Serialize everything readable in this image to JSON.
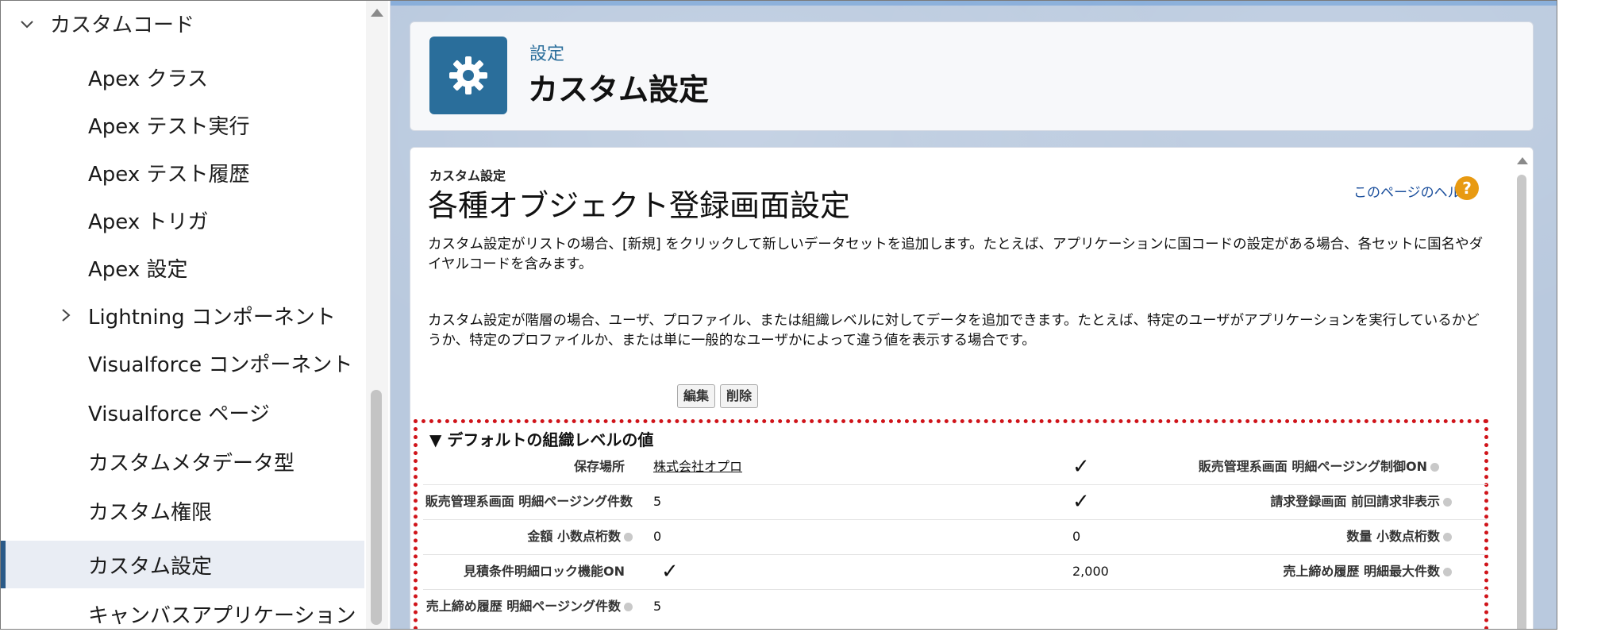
{
  "sidebar": {
    "section_label": "カスタムコード",
    "items": [
      {
        "label": "Apex クラス"
      },
      {
        "label": "Apex テスト実行"
      },
      {
        "label": "Apex テスト履歴"
      },
      {
        "label": "Apex トリガ"
      },
      {
        "label": "Apex 設定"
      },
      {
        "label": "Lightning コンポーネント"
      },
      {
        "label": "Visualforce コンポーネント"
      },
      {
        "label": "Visualforce ページ"
      },
      {
        "label": "カスタムメタデータ型"
      },
      {
        "label": "カスタム権限"
      },
      {
        "label": "カスタム設定"
      },
      {
        "label": "キャンバスアプリケーション"
      }
    ],
    "active_item": "カスタム設定"
  },
  "header": {
    "eyebrow": "設定",
    "title": "カスタム設定",
    "icon": "gear-icon"
  },
  "content": {
    "eyebrow": "カスタム設定",
    "title": "各種オブジェクト登録画面設定",
    "help_link": "このページのヘルプ",
    "help_icon": "?",
    "desc1": "カスタム設定がリストの場合、[新規] をクリックして新しいデータセットを追加します。たとえば、アプリケーションに国コードの設定がある場合、各セットに国名やダイヤルコードを含みます。",
    "desc2": "カスタム設定が階層の場合、ユーザ、プロファイル、または組織レベルに対してデータを追加できます。たとえば、特定のユーザがアプリケーションを実行しているかどうか、特定のプロファイルか、または単に一般的なユーザかによって違う値を表示する場合です。",
    "buttons": {
      "edit": "編集",
      "delete": "削除"
    }
  },
  "section": {
    "title": "▼ デフォルトの組織レベルの値",
    "rows": [
      {
        "left_label": "保存場所",
        "left_value": "株式会社オプロ",
        "right_label": "販売管理系画面 明細ページング制御ON",
        "right_value": "✓"
      },
      {
        "left_label": "販売管理系画面 明細ページング件数",
        "left_value": "5",
        "right_label": "請求登録画面 前回請求非表示",
        "right_value": "✓"
      },
      {
        "left_label": "金額 小数点桁数",
        "left_value": "0",
        "right_label": "数量 小数点桁数",
        "right_value": "0"
      },
      {
        "left_label": "見積条件明細ロック機能ON",
        "left_value": "✓",
        "right_label": "売上締め履歴 明細最大件数",
        "right_value": "2,000"
      },
      {
        "left_label": "売上締め履歴 明細ページング件数",
        "left_value": "5",
        "right_label": "",
        "right_value": ""
      }
    ]
  },
  "colors": {
    "header_icon_bg": "#2a6e9b",
    "highlight_border": "#d0141a",
    "help_icon_bg": "#e89a12",
    "main_bg": "#b9c9de"
  }
}
